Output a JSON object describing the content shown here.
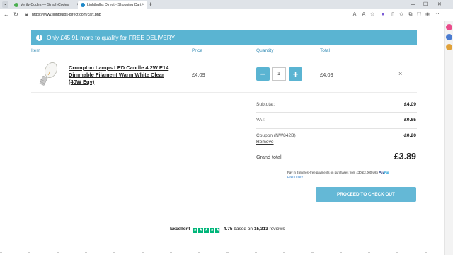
{
  "browser": {
    "tabs": [
      {
        "title": "Verify Codes — SimplyCodes",
        "active": false,
        "color": "#4caf50"
      },
      {
        "title": "Lightbulbs Direct - Shopping Cart",
        "active": true,
        "color": "#1e88c8"
      }
    ],
    "url": "https://www.lightbulbs-direct.com/cart.php",
    "new_tab": "+",
    "window_controls": [
      "—",
      "☐",
      "✕"
    ]
  },
  "banner": {
    "prefix": "Only ",
    "amount": "£45.91",
    "middle": " more to qualify for ",
    "highlight": "FREE DELIVERY"
  },
  "columns": {
    "item": "Item",
    "price": "Price",
    "quantity": "Quantity",
    "total": "Total"
  },
  "cart_item": {
    "name": "Crompton Lamps LED Candle 4.2W E14 Dimmable Filament Warm White Clear (40W Eqv)",
    "price": "£4.09",
    "quantity": "1",
    "total": "£4.09",
    "minus": "−",
    "plus": "+",
    "remove": "×"
  },
  "summary": {
    "subtotal_label": "Subtotal:",
    "subtotal": "£4.09",
    "vat_label": "VAT:",
    "vat": "£0.65",
    "coupon_label": "Coupon (NW842B)",
    "coupon": "-£0.20",
    "remove_label": "Remove",
    "grand_label": "Grand total:",
    "grand": "£3.89"
  },
  "paypal": {
    "text": "Pay in 3 interest-free payments on purchases from £30-£2,000 with",
    "brand_a": "Pay",
    "brand_b": "Pal",
    "learn_more": "Learn more"
  },
  "checkout_label": "PROCEED TO CHECK OUT",
  "trustpilot": {
    "rating_word": "Excellent",
    "score": "4.75",
    "based_on": "based on",
    "count": "15,313",
    "reviews": "reviews",
    "stars": 4.75
  },
  "colors": {
    "accent": "#5ab4d2",
    "header_text": "#3a8fb7",
    "trust_green": "#00b67a"
  }
}
